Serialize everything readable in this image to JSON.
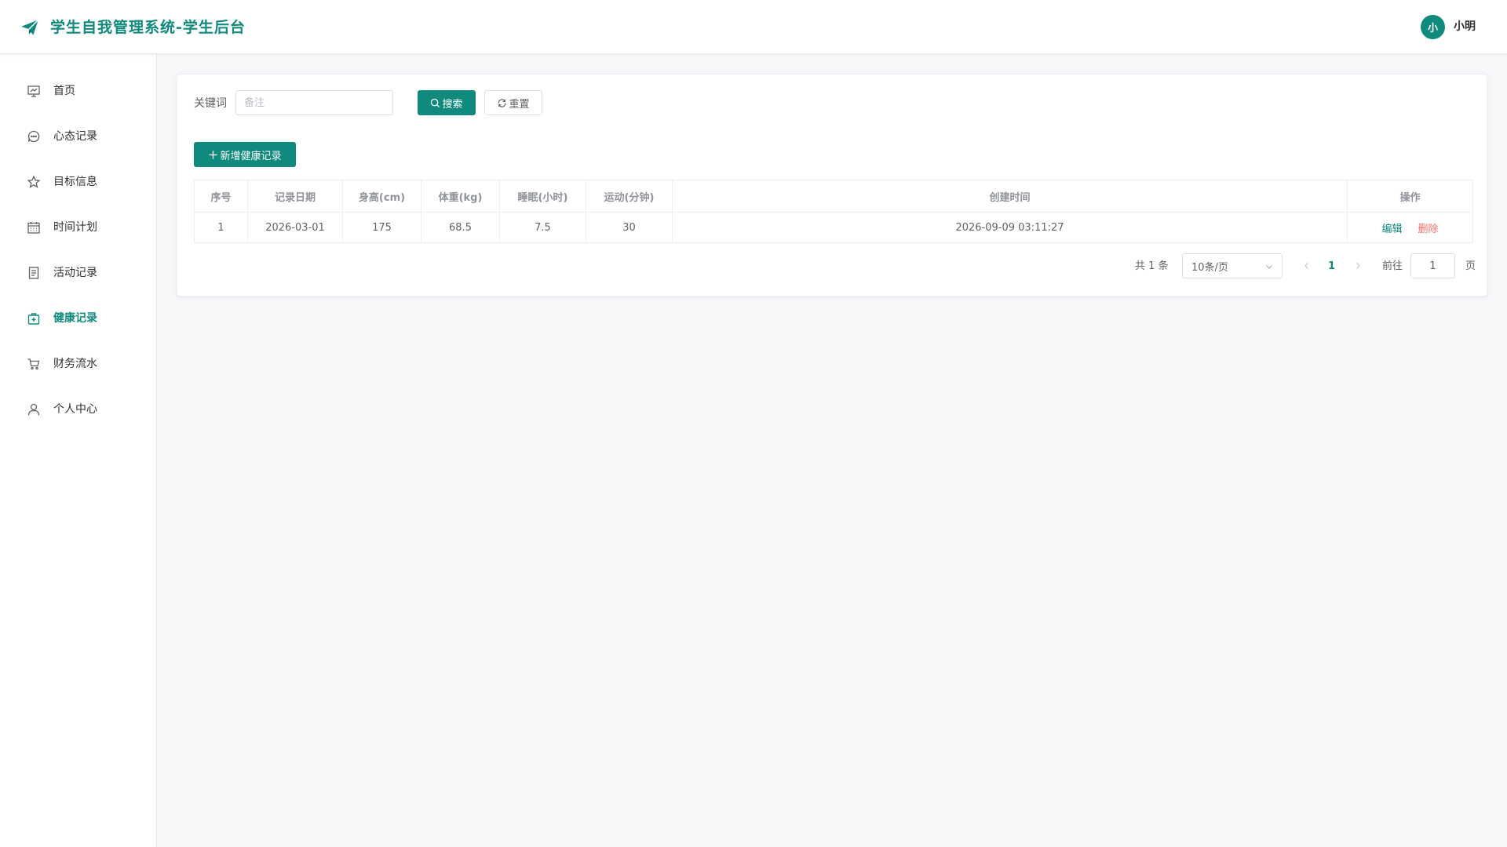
{
  "header": {
    "title": "学生自我管理系统-学生后台",
    "avatar_text": "小",
    "user_name": "小明"
  },
  "sidebar": {
    "items": [
      {
        "label": "首页",
        "icon": "chart-board-icon"
      },
      {
        "label": "心态记录",
        "icon": "chat-bubble-icon"
      },
      {
        "label": "目标信息",
        "icon": "star-icon"
      },
      {
        "label": "时间计划",
        "icon": "calendar-icon"
      },
      {
        "label": "活动记录",
        "icon": "document-icon"
      },
      {
        "label": "健康记录",
        "icon": "first-aid-kit-icon",
        "active": true
      },
      {
        "label": "财务流水",
        "icon": "cart-icon"
      },
      {
        "label": "个人中心",
        "icon": "user-icon"
      }
    ]
  },
  "search": {
    "label": "关键词",
    "placeholder": "备注",
    "value": "",
    "search_button": "搜索",
    "reset_button": "重置"
  },
  "toolbar": {
    "add_button": "新增健康记录"
  },
  "table": {
    "columns": [
      "序号",
      "记录日期",
      "身高(cm)",
      "体重(kg)",
      "睡眠(小时)",
      "运动(分钟)",
      "创建时间",
      "操作"
    ],
    "rows": [
      {
        "index": "1",
        "date": "2026-03-01",
        "height": "175",
        "weight": "68.5",
        "sleep": "7.5",
        "exercise": "30",
        "created_at": "2026-09-09 03:11:27",
        "edit": "编辑",
        "delete": "删除"
      }
    ]
  },
  "pagination": {
    "total_text": "共 1 条",
    "page_size": "10条/页",
    "current_page": "1",
    "goto_label": "前往",
    "goto_value": "1",
    "page_suffix": "页"
  },
  "colors": {
    "accent": "#0f8a7d",
    "danger": "#f56c6c"
  }
}
